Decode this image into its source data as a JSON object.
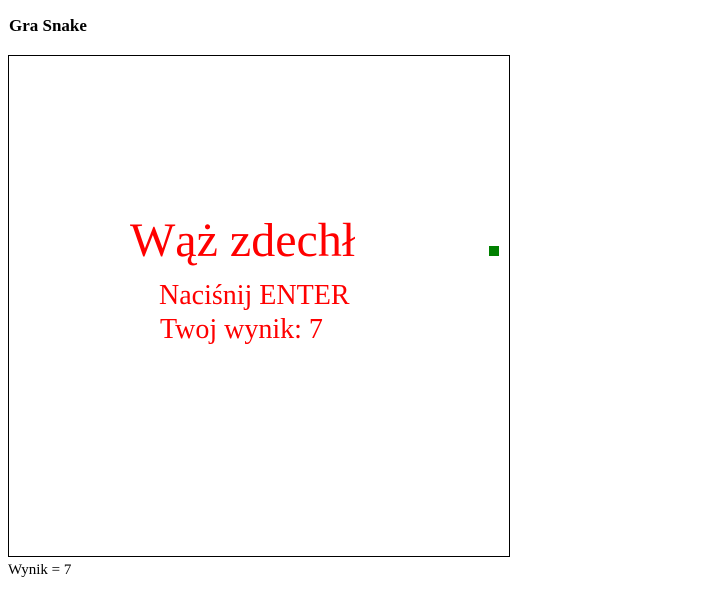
{
  "page": {
    "title": "Gra Snake"
  },
  "game": {
    "game_over_text": "Wąż zdechł",
    "press_enter_text": "Naciśnij ENTER",
    "final_score_text": "Twoj wynik: 7",
    "message_color": "#ff0000",
    "food_color": "#008000",
    "board_border_color": "#000000",
    "board_background": "#ffffff"
  },
  "footer": {
    "score_text": "Wynik = 7"
  }
}
